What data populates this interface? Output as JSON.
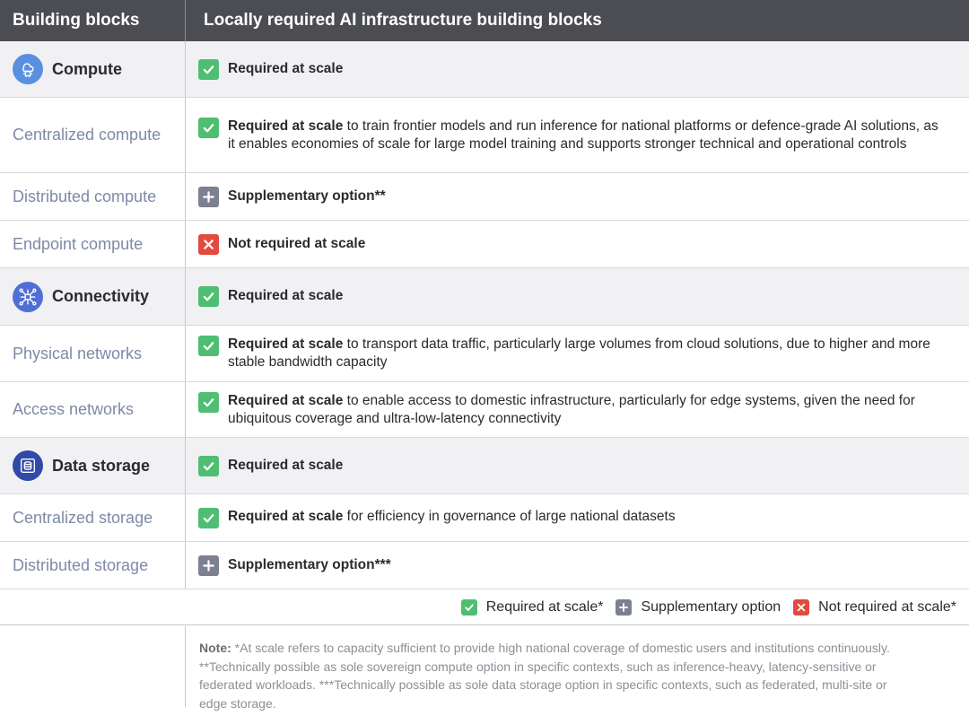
{
  "header": {
    "col1": "Building blocks",
    "col2": "Locally required AI infrastructure building blocks"
  },
  "rows": [
    {
      "type": "cat",
      "label": "Compute",
      "icon": "compute-chip-icon",
      "icon_color": "#5a8fe0",
      "status": "check",
      "bold": "Required at scale",
      "rest": ""
    },
    {
      "type": "sub",
      "label": "Centralized compute",
      "status": "check",
      "bold": "Required at scale",
      "rest": " to train frontier models and run inference for national platforms or defence-grade AI solutions, as it enables economies of scale for large model training and supports stronger technical and operational controls"
    },
    {
      "type": "sub",
      "label": "Distributed compute",
      "status": "plus",
      "bold": "Supplementary option**",
      "rest": ""
    },
    {
      "type": "sub",
      "label": "Endpoint compute",
      "status": "cross",
      "bold": "Not required at scale",
      "rest": ""
    },
    {
      "type": "cat",
      "label": "Connectivity",
      "icon": "network-hub-icon",
      "icon_color": "#4f6fd6",
      "status": "check",
      "bold": "Required at scale",
      "rest": ""
    },
    {
      "type": "sub",
      "label": "Physical networks",
      "status": "check",
      "bold": "Required at scale",
      "rest": " to transport data traffic, particularly large volumes from cloud solutions, due to higher and more stable bandwidth capacity"
    },
    {
      "type": "sub",
      "label": "Access networks",
      "status": "check",
      "bold": "Required at scale",
      "rest": " to enable access to domestic infrastructure, particularly for edge systems, given the need for ubiquitous coverage and ultra-low-latency connectivity"
    },
    {
      "type": "cat",
      "label": "Data storage",
      "icon": "database-icon",
      "icon_color": "#2f4aa8",
      "status": "check",
      "bold": "Required at scale",
      "rest": ""
    },
    {
      "type": "sub",
      "label": "Centralized storage",
      "status": "check",
      "bold": "Required at scale",
      "rest": " for efficiency in governance of large national datasets"
    },
    {
      "type": "sub",
      "label": "Distributed storage",
      "status": "plus",
      "bold": "Supplementary option***",
      "rest": ""
    }
  ],
  "legend": {
    "required": "Required at scale*",
    "supplementary": "Supplementary option",
    "not_required": "Not required at scale*"
  },
  "note": {
    "label": "Note:",
    "text": " *At scale refers to capacity sufficient to provide high national coverage of domestic users and institutions continuously. **Technically possible as sole sovereign compute option in specific contexts, such as inference-heavy, latency-sensitive or federated workloads. ***Technically possible as sole data storage option in specific contexts, such as federated, multi-site or edge storage."
  },
  "colors": {
    "header_bg": "#4b4d52",
    "check": "#4fbe72",
    "plus": "#7c8191",
    "cross": "#e24a3f",
    "sub_label": "#7d8aa6"
  }
}
